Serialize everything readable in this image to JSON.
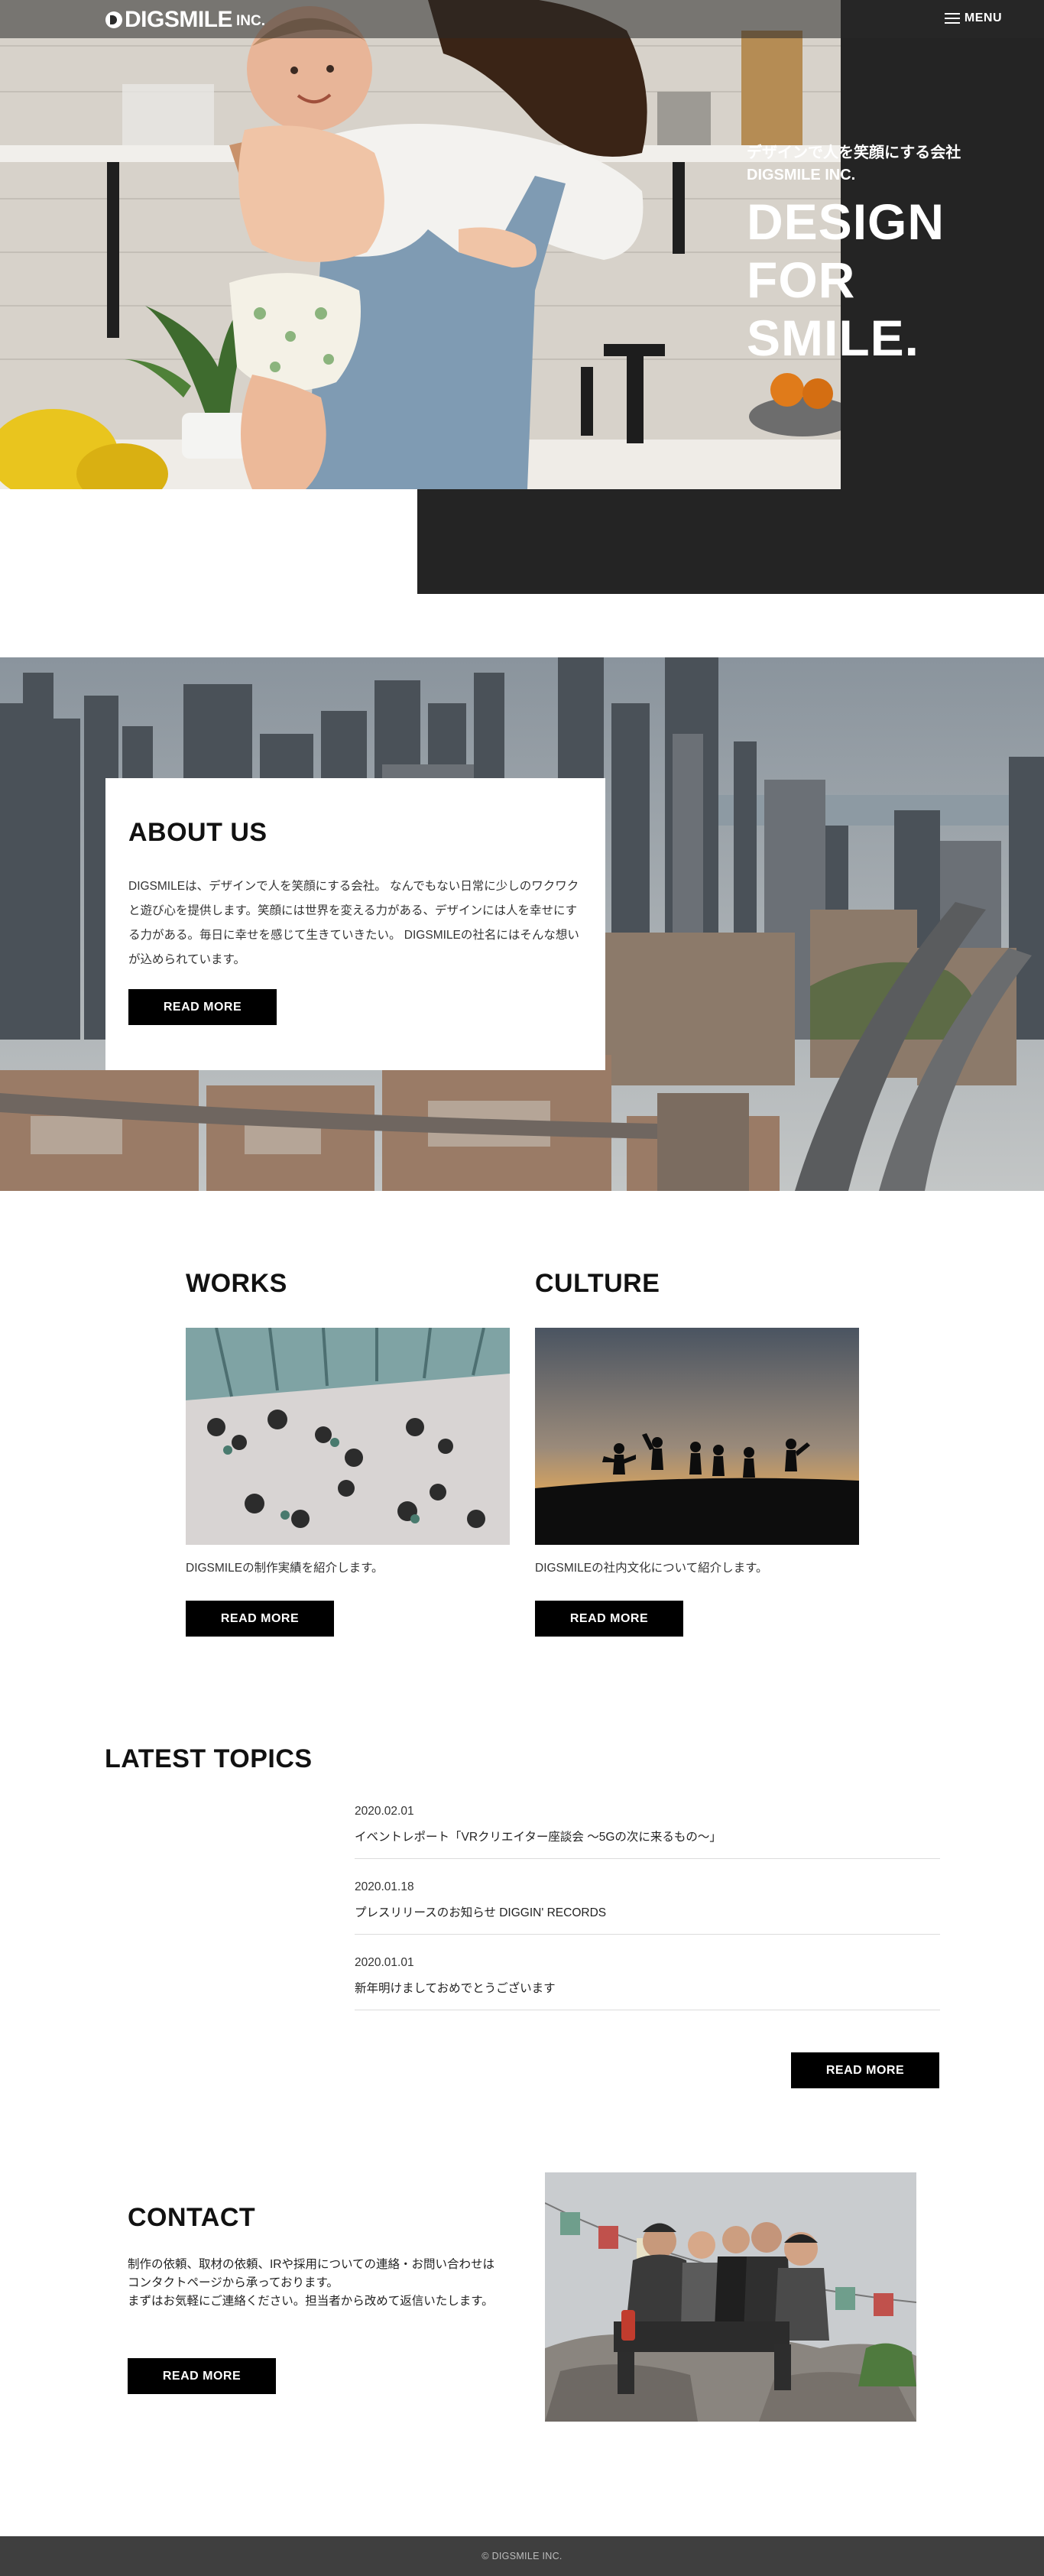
{
  "header": {
    "logo_name": "DIGSMILE",
    "logo_suffix": "INC.",
    "menu_label": "MENU"
  },
  "hero": {
    "subtitle_line1": "デザインで人を笑顔にする会社",
    "subtitle_line2": "DIGSMILE INC.",
    "title_line1": "DESIGN",
    "title_line2": "FOR",
    "title_line3": "SMILE."
  },
  "about": {
    "heading": "ABOUT US",
    "text": "DIGSMILEは、デザインで人を笑顔にする会社。 なんでもない日常に少しのワクワクと遊び心を提供します。笑顔には世界を変える力がある、デザインには人を幸せにする力がある。毎日に幸せを感じて生きていきたい。 DIGSMILEの社名にはそんな想いが込められています。",
    "button": "READ MORE"
  },
  "works": {
    "heading": "WORKS",
    "text": "DIGSMILEの制作実績を紹介します。",
    "button": "READ MORE"
  },
  "culture": {
    "heading": "CULTURE",
    "text": "DIGSMILEの社内文化について紹介します。",
    "button": "READ MORE"
  },
  "topics": {
    "heading": "LATEST TOPICS",
    "items": [
      {
        "date": "2020.02.01",
        "title": "イベントレポート「VRクリエイター座談会 ～5Gの次に来るもの～」"
      },
      {
        "date": "2020.01.18",
        "title": "プレスリリースのお知らせ DIGGIN' RECORDS"
      },
      {
        "date": "2020.01.01",
        "title": "新年明けましておめでとうございます"
      }
    ],
    "button": "READ MORE"
  },
  "contact": {
    "heading": "CONTACT",
    "text_line1": "制作の依頼、取材の依頼、IRや採用についての連絡・お問い合わせはコンタクトページから承っております。",
    "text_line2": "まずはお気軽にご連絡ください。担当者から改めて返信いたします。",
    "button": "READ MORE"
  },
  "footer": {
    "copyright": "© DIGSMILE INC."
  },
  "colors": {
    "dark_panel": "#242424",
    "button": "#000000",
    "footer": "#3f3f3f"
  }
}
